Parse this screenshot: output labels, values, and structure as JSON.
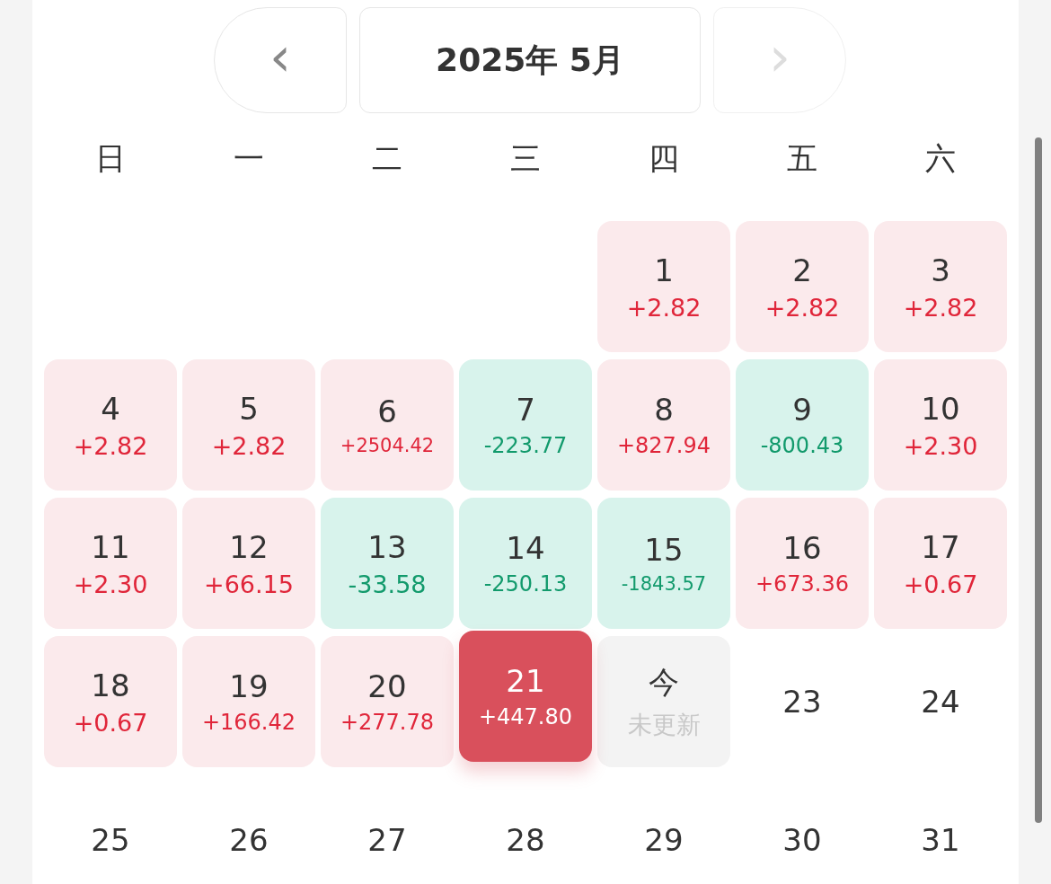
{
  "header": {
    "prev": "‹",
    "title": "2025年 5月",
    "next": "›",
    "next_disabled": true
  },
  "weekdays": [
    "日",
    "一",
    "二",
    "三",
    "四",
    "五",
    "六"
  ],
  "days": [
    {
      "kind": "blank"
    },
    {
      "kind": "blank"
    },
    {
      "kind": "blank"
    },
    {
      "kind": "blank"
    },
    {
      "kind": "gain",
      "day": "1",
      "value": "+2.82",
      "selected": false
    },
    {
      "kind": "gain",
      "day": "2",
      "value": "+2.82",
      "selected": false
    },
    {
      "kind": "gain",
      "day": "3",
      "value": "+2.82",
      "selected": false
    },
    {
      "kind": "gain",
      "day": "4",
      "value": "+2.82",
      "selected": false
    },
    {
      "kind": "gain",
      "day": "5",
      "value": "+2.82",
      "selected": false
    },
    {
      "kind": "gain",
      "day": "6",
      "value": "+2504.42",
      "selected": false
    },
    {
      "kind": "loss",
      "day": "7",
      "value": "-223.77",
      "selected": false
    },
    {
      "kind": "gain",
      "day": "8",
      "value": "+827.94",
      "selected": false
    },
    {
      "kind": "loss",
      "day": "9",
      "value": "-800.43",
      "selected": false
    },
    {
      "kind": "gain",
      "day": "10",
      "value": "+2.30",
      "selected": false
    },
    {
      "kind": "gain",
      "day": "11",
      "value": "+2.30",
      "selected": false
    },
    {
      "kind": "gain",
      "day": "12",
      "value": "+66.15",
      "selected": false
    },
    {
      "kind": "loss",
      "day": "13",
      "value": "-33.58",
      "selected": false
    },
    {
      "kind": "loss",
      "day": "14",
      "value": "-250.13",
      "selected": false
    },
    {
      "kind": "loss",
      "day": "15",
      "value": "-1843.57",
      "selected": false
    },
    {
      "kind": "gain",
      "day": "16",
      "value": "+673.36",
      "selected": false
    },
    {
      "kind": "gain",
      "day": "17",
      "value": "+0.67",
      "selected": false
    },
    {
      "kind": "gain",
      "day": "18",
      "value": "+0.67",
      "selected": false
    },
    {
      "kind": "gain",
      "day": "19",
      "value": "+166.42",
      "selected": false
    },
    {
      "kind": "gain",
      "day": "20",
      "value": "+277.78",
      "selected": false
    },
    {
      "kind": "gain",
      "day": "21",
      "value": "+447.80",
      "selected": true
    },
    {
      "kind": "today",
      "day": "今",
      "value": "未更新",
      "selected": false
    },
    {
      "kind": "future",
      "day": "23",
      "selected": false
    },
    {
      "kind": "future",
      "day": "24",
      "selected": false
    },
    {
      "kind": "future",
      "day": "25",
      "selected": false
    },
    {
      "kind": "future",
      "day": "26",
      "selected": false
    },
    {
      "kind": "future",
      "day": "27",
      "selected": false
    },
    {
      "kind": "future",
      "day": "28",
      "selected": false
    },
    {
      "kind": "future",
      "day": "29",
      "selected": false
    },
    {
      "kind": "future",
      "day": "30",
      "selected": false
    },
    {
      "kind": "future",
      "day": "31",
      "selected": false
    }
  ]
}
